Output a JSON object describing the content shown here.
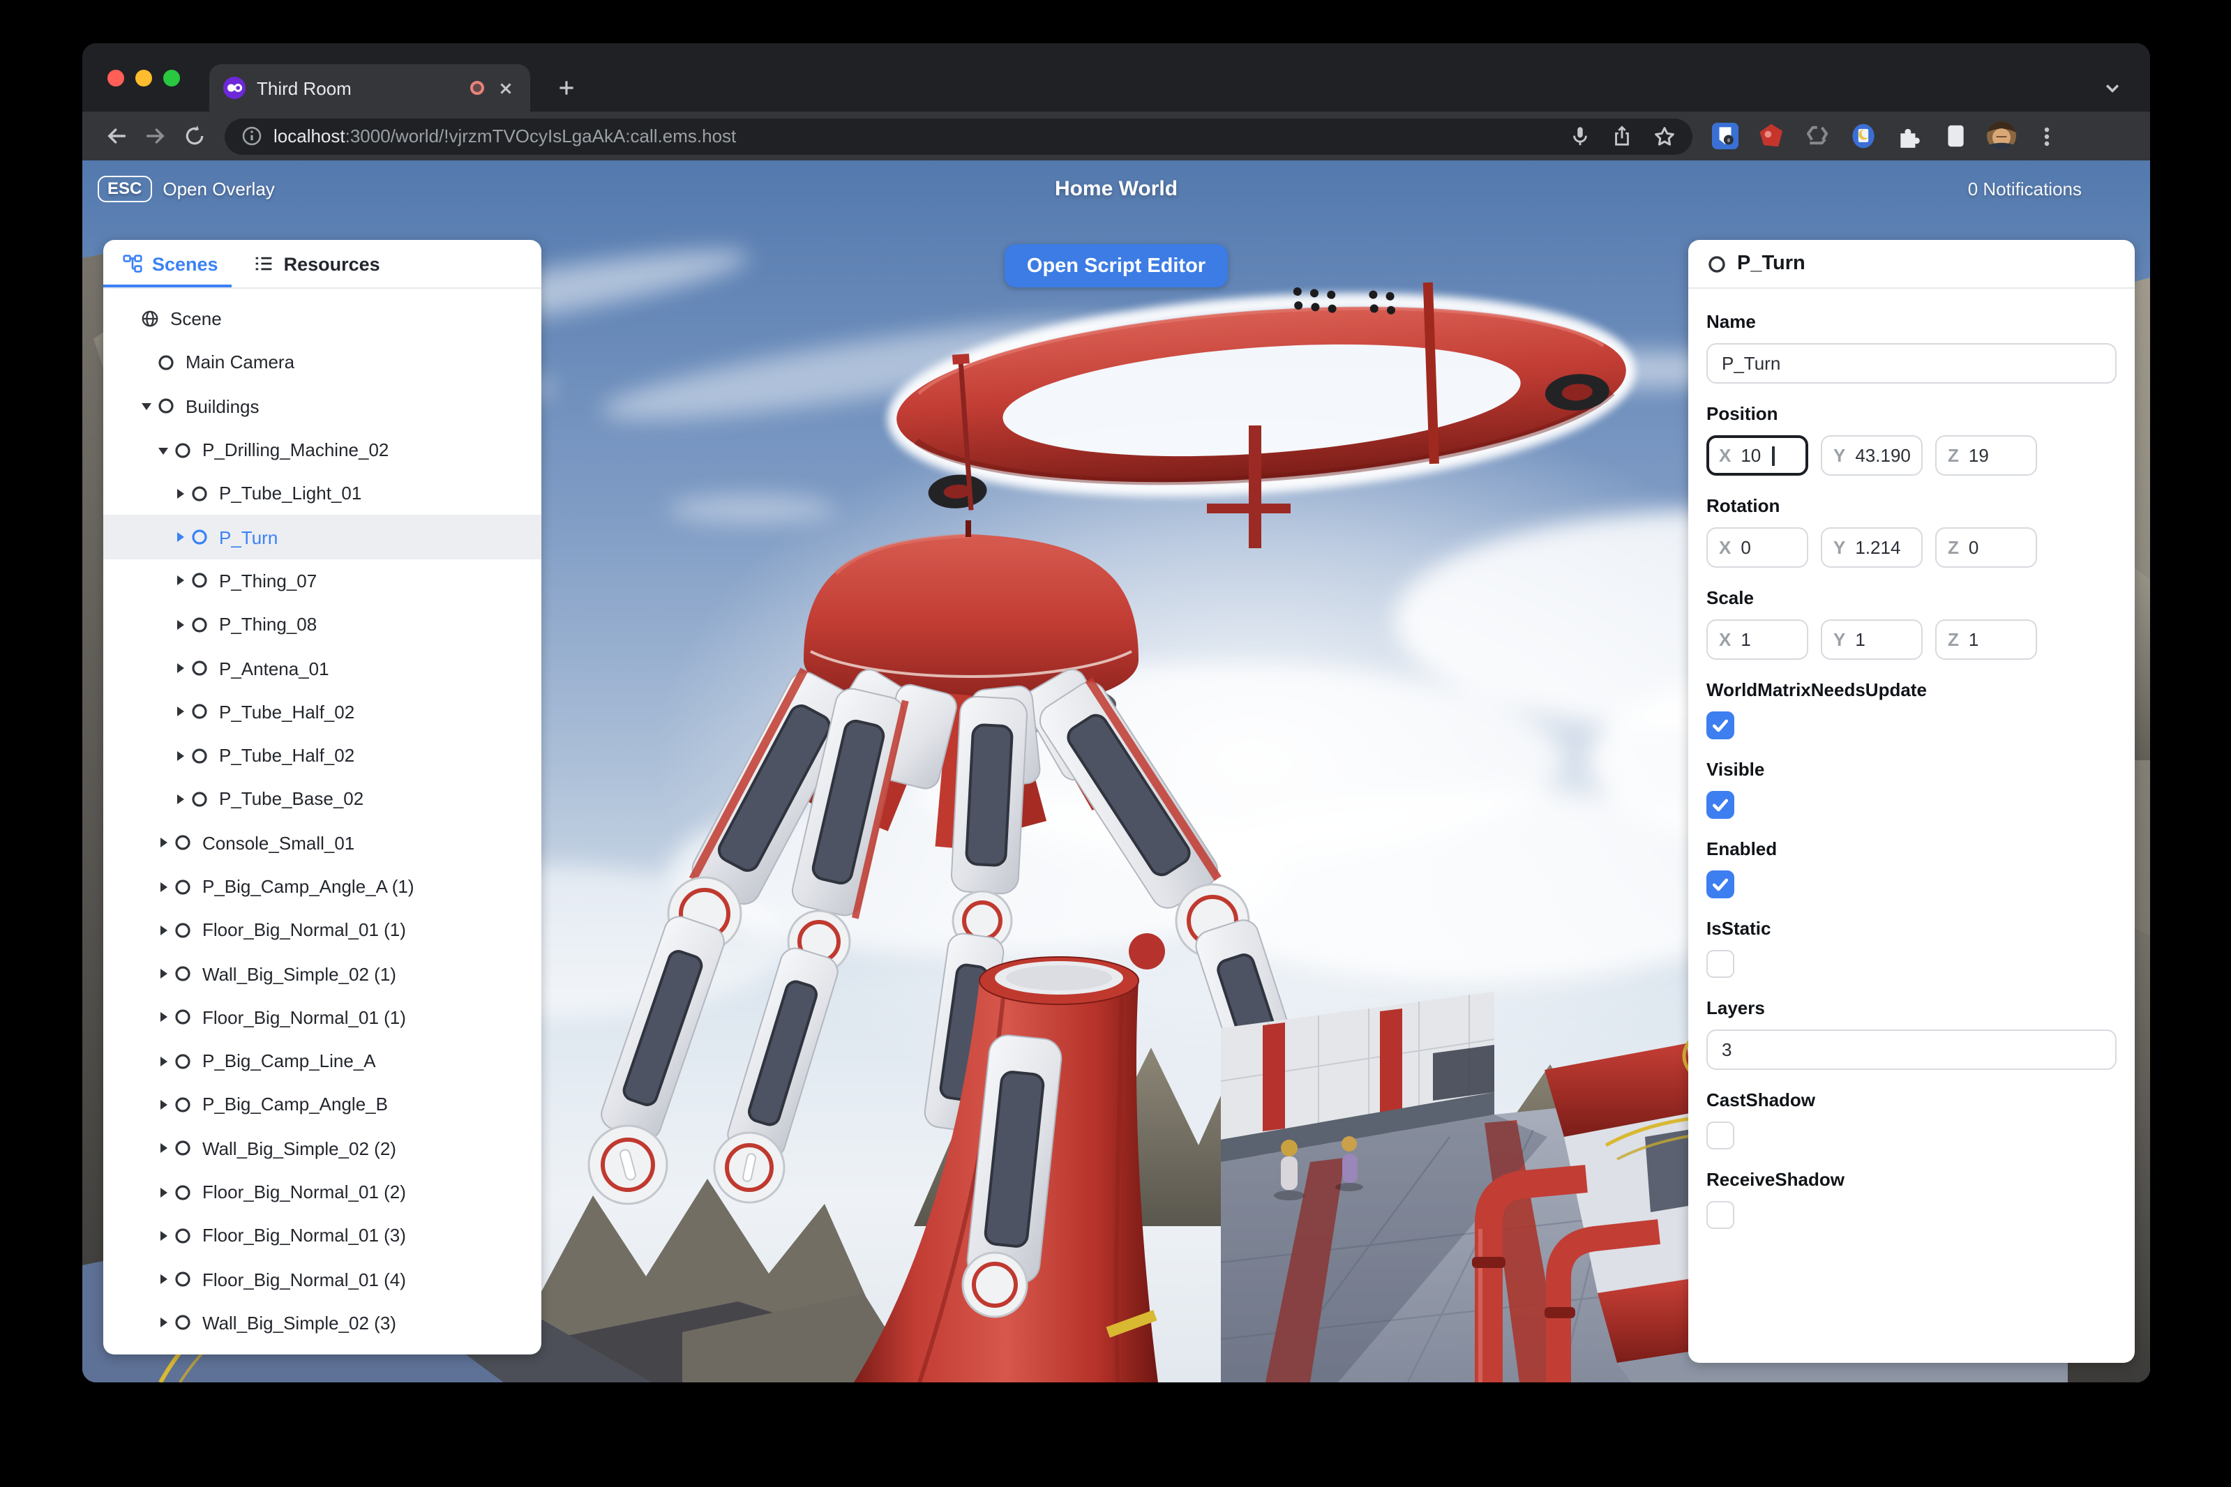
{
  "browser": {
    "tab_title": "Third Room",
    "url_host": "localhost",
    "url_rest": ":3000/world/!vjrzmTVOcyIsLgaAkA:call.ems.host"
  },
  "hud": {
    "esc_key": "ESC",
    "open_overlay_label": "Open Overlay",
    "world_title": "Home World",
    "notifications": "0 Notifications",
    "open_script_editor": "Open Script Editor"
  },
  "scene_panel": {
    "tabs": [
      {
        "label": "Scenes",
        "icon": "hierarchy",
        "active": true
      },
      {
        "label": "Resources",
        "icon": "list",
        "active": false
      }
    ],
    "tree": [
      {
        "label": "Scene",
        "level": 0,
        "icon": "globe",
        "caret": null
      },
      {
        "label": "Main Camera",
        "level": 1,
        "icon": "circle",
        "caret": null
      },
      {
        "label": "Buildings",
        "level": 1,
        "icon": "circle",
        "caret": "down"
      },
      {
        "label": "P_Drilling_Machine_02",
        "level": 2,
        "icon": "circle",
        "caret": "down"
      },
      {
        "label": "P_Tube_Light_01",
        "level": 3,
        "icon": "circle",
        "caret": "right"
      },
      {
        "label": "P_Turn",
        "level": 3,
        "icon": "circle",
        "caret": "right",
        "selected": true
      },
      {
        "label": "P_Thing_07",
        "level": 3,
        "icon": "circle",
        "caret": "right"
      },
      {
        "label": "P_Thing_08",
        "level": 3,
        "icon": "circle",
        "caret": "right"
      },
      {
        "label": "P_Antena_01",
        "level": 3,
        "icon": "circle",
        "caret": "right"
      },
      {
        "label": "P_Tube_Half_02",
        "level": 3,
        "icon": "circle",
        "caret": "right"
      },
      {
        "label": "P_Tube_Half_02",
        "level": 3,
        "icon": "circle",
        "caret": "right"
      },
      {
        "label": "P_Tube_Base_02",
        "level": 3,
        "icon": "circle",
        "caret": "right"
      },
      {
        "label": "Console_Small_01",
        "level": 2,
        "icon": "circle",
        "caret": "right"
      },
      {
        "label": "P_Big_Camp_Angle_A (1)",
        "level": 2,
        "icon": "circle",
        "caret": "right"
      },
      {
        "label": "Floor_Big_Normal_01 (1)",
        "level": 2,
        "icon": "circle",
        "caret": "right"
      },
      {
        "label": "Wall_Big_Simple_02 (1)",
        "level": 2,
        "icon": "circle",
        "caret": "right"
      },
      {
        "label": "Floor_Big_Normal_01 (1)",
        "level": 2,
        "icon": "circle",
        "caret": "right"
      },
      {
        "label": "P_Big_Camp_Line_A",
        "level": 2,
        "icon": "circle",
        "caret": "right"
      },
      {
        "label": "P_Big_Camp_Angle_B",
        "level": 2,
        "icon": "circle",
        "caret": "right"
      },
      {
        "label": "Wall_Big_Simple_02 (2)",
        "level": 2,
        "icon": "circle",
        "caret": "right"
      },
      {
        "label": "Floor_Big_Normal_01 (2)",
        "level": 2,
        "icon": "circle",
        "caret": "right"
      },
      {
        "label": "Floor_Big_Normal_01 (3)",
        "level": 2,
        "icon": "circle",
        "caret": "right"
      },
      {
        "label": "Floor_Big_Normal_01 (4)",
        "level": 2,
        "icon": "circle",
        "caret": "right"
      },
      {
        "label": "Wall_Big_Simple_02 (3)",
        "level": 2,
        "icon": "circle",
        "caret": "right"
      }
    ]
  },
  "inspector": {
    "title": "P_Turn",
    "fields": [
      {
        "type": "text",
        "label": "Name",
        "value": "P_Turn"
      },
      {
        "type": "vec3",
        "label": "Position",
        "axes": [
          {
            "axis": "X",
            "value": "10",
            "focused": true
          },
          {
            "axis": "Y",
            "value": "43.190"
          },
          {
            "axis": "Z",
            "value": "19"
          }
        ]
      },
      {
        "type": "vec3",
        "label": "Rotation",
        "axes": [
          {
            "axis": "X",
            "value": "0"
          },
          {
            "axis": "Y",
            "value": "1.214"
          },
          {
            "axis": "Z",
            "value": "0"
          }
        ]
      },
      {
        "type": "vec3",
        "label": "Scale",
        "axes": [
          {
            "axis": "X",
            "value": "1"
          },
          {
            "axis": "Y",
            "value": "1"
          },
          {
            "axis": "Z",
            "value": "1"
          }
        ]
      },
      {
        "type": "checkbox",
        "label": "WorldMatrixNeedsUpdate",
        "checked": true
      },
      {
        "type": "checkbox",
        "label": "Visible",
        "checked": true
      },
      {
        "type": "checkbox",
        "label": "Enabled",
        "checked": true
      },
      {
        "type": "checkbox",
        "label": "IsStatic",
        "checked": false
      },
      {
        "type": "text",
        "label": "Layers",
        "value": "3"
      },
      {
        "type": "checkbox",
        "label": "CastShadow",
        "checked": false
      },
      {
        "type": "checkbox",
        "label": "ReceiveShadow",
        "checked": false
      }
    ]
  },
  "colors": {
    "accent_blue": "#3b82f6",
    "button_blue": "#3c7ce4",
    "checkbox_blue": "#3d7ef0",
    "machine_red": "#c23d34",
    "traffic_lights": [
      "#ff5f57",
      "#febc2e",
      "#28c840"
    ]
  }
}
